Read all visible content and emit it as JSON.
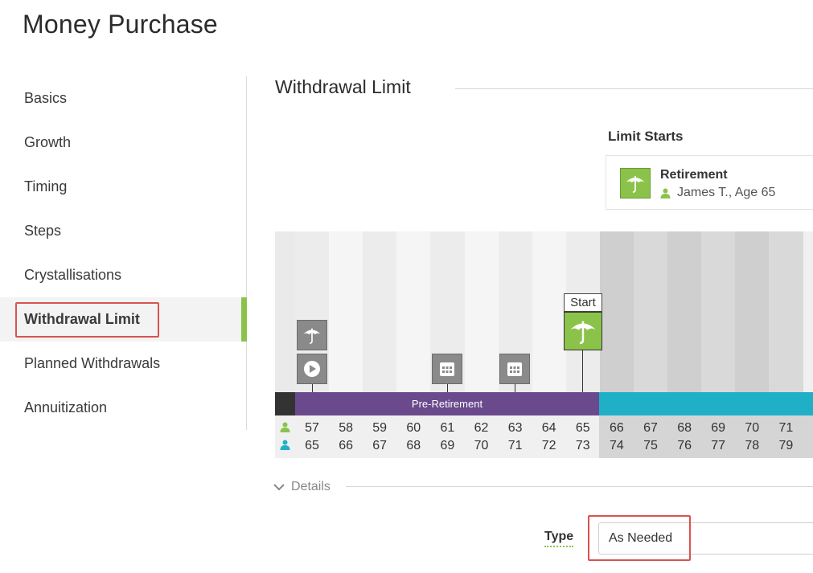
{
  "page": {
    "title": "Money Purchase"
  },
  "sidebar": {
    "items": [
      {
        "label": "Basics",
        "active": false
      },
      {
        "label": "Growth",
        "active": false
      },
      {
        "label": "Timing",
        "active": false
      },
      {
        "label": "Steps",
        "active": false
      },
      {
        "label": "Crystallisations",
        "active": false
      },
      {
        "label": "Withdrawal Limit",
        "active": true
      },
      {
        "label": "Planned Withdrawals",
        "active": false
      },
      {
        "label": "Annuitization",
        "active": false
      }
    ]
  },
  "section": {
    "title": "Withdrawal Limit"
  },
  "limit_starts": {
    "heading": "Limit Starts",
    "event_name": "Retirement",
    "person_age": "James T., Age 65",
    "icon": "umbrella-icon"
  },
  "timeline": {
    "phase_label": "Pre-Retirement",
    "start_label": "Start",
    "person1_ages": [
      "57",
      "58",
      "59",
      "60",
      "61",
      "62",
      "63",
      "64",
      "65",
      "66",
      "67",
      "68",
      "69",
      "70",
      "71"
    ],
    "person2_ages": [
      "65",
      "66",
      "67",
      "68",
      "69",
      "70",
      "71",
      "72",
      "73",
      "74",
      "75",
      "76",
      "77",
      "78",
      "79"
    ],
    "colors": {
      "pre": "#6a4a8c",
      "post": "#1fb0c8",
      "accent": "#8bc34a",
      "person1": "#8bc34a",
      "person2": "#1fb0c8"
    }
  },
  "details": {
    "label": "Details"
  },
  "type_field": {
    "label": "Type",
    "value": "As Needed"
  }
}
